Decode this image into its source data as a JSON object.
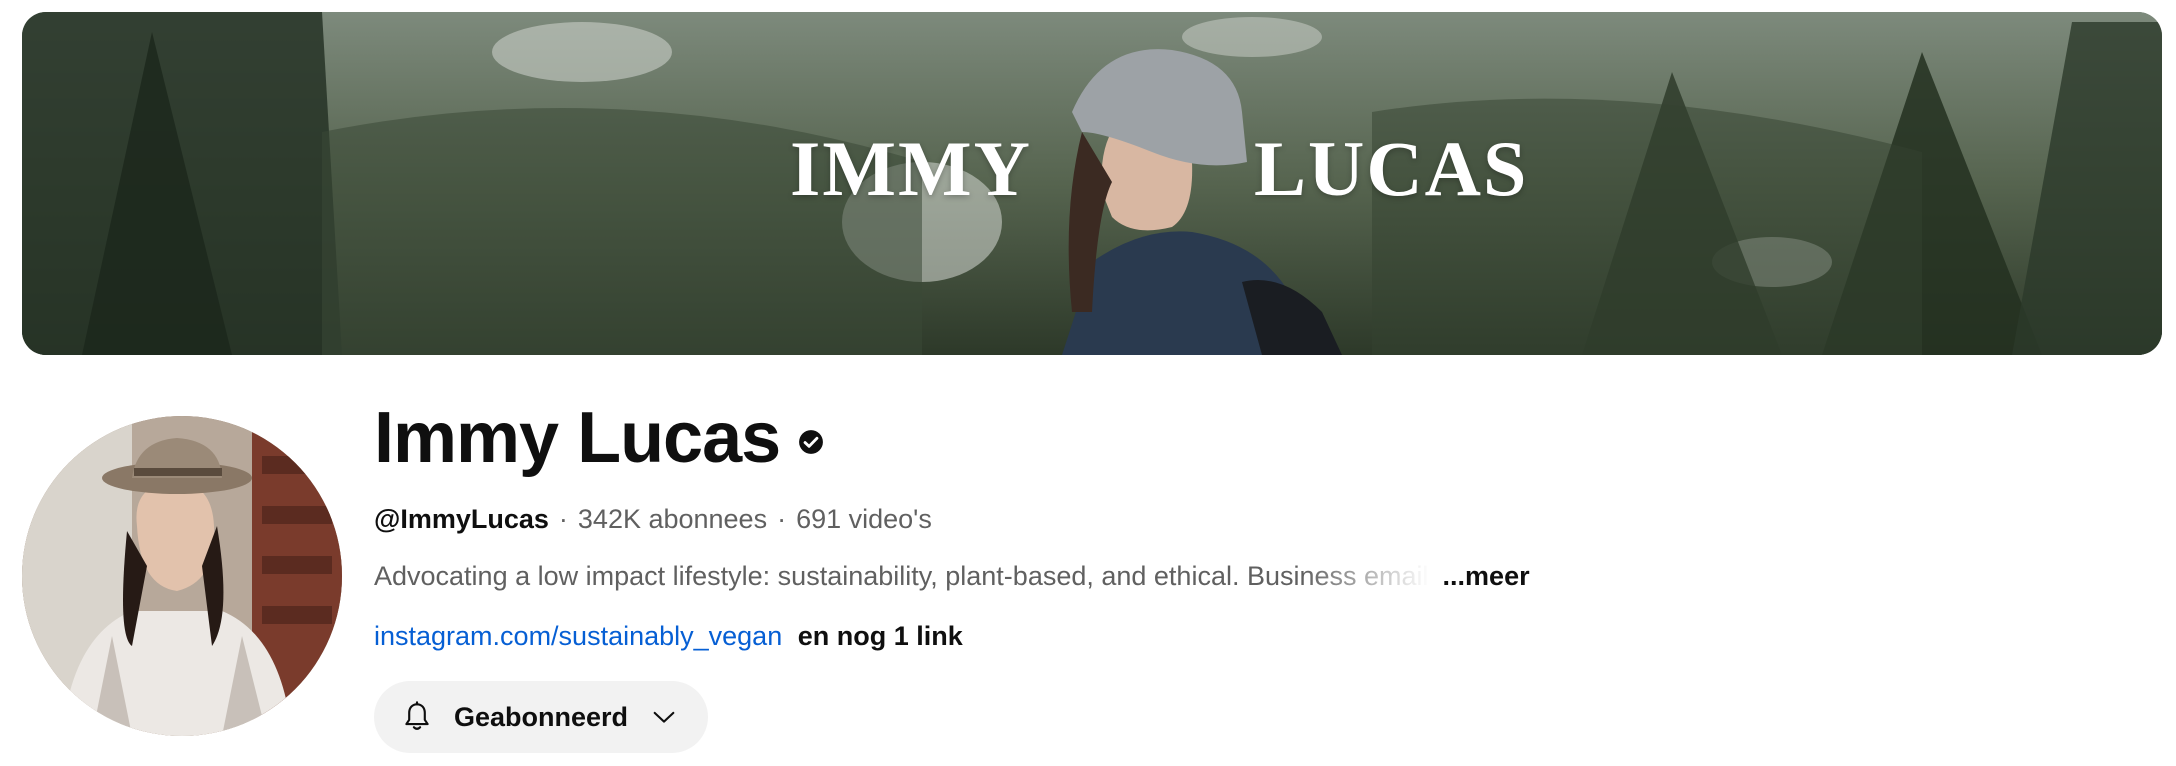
{
  "banner": {
    "title_first": "IMMY",
    "title_last": "LUCAS"
  },
  "channel": {
    "name": "Immy Lucas",
    "handle": "@ImmyLucas",
    "separator": "·",
    "subscribers": "342K abonnees",
    "videos": "691 video's",
    "description": "Advocating a low impact lifestyle: sustainability, plant-based, and ethical. Business email",
    "more_label": "...meer",
    "link_text": "instagram.com/sustainably_vegan",
    "more_links": "en nog 1 link"
  },
  "subscribe_button": {
    "label": "Geabonneerd",
    "icon": "bell-icon",
    "dropdown_icon": "chevron-down-icon"
  },
  "colors": {
    "link": "#065fd4",
    "button_bg": "#f2f2f2",
    "text_primary": "#0f0f0f",
    "text_secondary": "#606060"
  }
}
